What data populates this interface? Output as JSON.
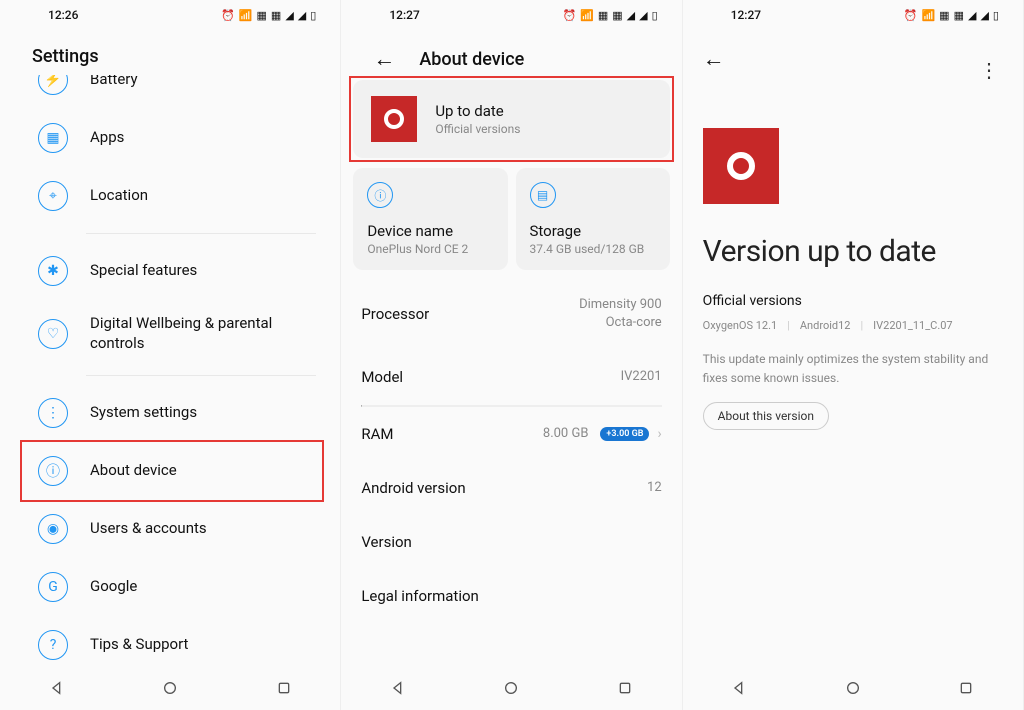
{
  "screen1": {
    "time": "12:26",
    "header": "Settings",
    "items_top": [
      {
        "label": "Battery",
        "icon": "⚡"
      },
      {
        "label": "Apps",
        "icon": "▦"
      },
      {
        "label": "Location",
        "icon": "⌖"
      }
    ],
    "items_mid": [
      {
        "label": "Special features",
        "icon": "✱"
      },
      {
        "label": "Digital Wellbeing & parental controls",
        "icon": "♡"
      }
    ],
    "items_bottom": [
      {
        "label": "System settings",
        "icon": "⋮"
      },
      {
        "label": "About device",
        "icon": "ⓘ"
      },
      {
        "label": "Users & accounts",
        "icon": "◉"
      },
      {
        "label": "Google",
        "icon": "G"
      },
      {
        "label": "Tips & Support",
        "icon": "?"
      }
    ]
  },
  "screen2": {
    "time": "12:27",
    "header": "About device",
    "update_card": {
      "title": "Up to date",
      "sub": "Official versions"
    },
    "device_card": {
      "label": "Device name",
      "value": "OnePlus Nord CE 2"
    },
    "storage_card": {
      "label": "Storage",
      "value": "37.4 GB used/128 GB"
    },
    "specs": {
      "processor_label": "Processor",
      "processor_value1": "Dimensity 900",
      "processor_value2": "Octa-core",
      "model_label": "Model",
      "model_value": "IV2201",
      "ram_label": "RAM",
      "ram_value": "8.00 GB",
      "ram_badge": "+3.00 GB",
      "android_label": "Android version",
      "android_value": "12",
      "version_label": "Version",
      "legal_label": "Legal information"
    }
  },
  "screen3": {
    "time": "12:27",
    "title": "Version up to date",
    "sub": "Official versions",
    "meta": {
      "os": "OxygenOS 12.1",
      "android": "Android12",
      "build": "IV2201_11_C.07"
    },
    "desc": "This update mainly optimizes the system stability and fixes some known issues.",
    "btn": "About this version"
  }
}
